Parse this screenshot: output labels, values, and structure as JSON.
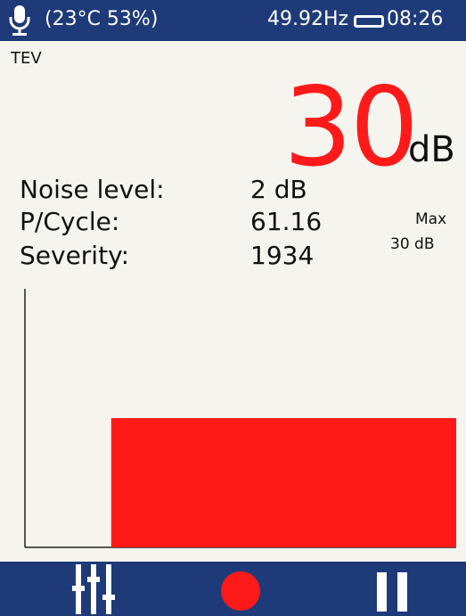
{
  "status": {
    "environment": "(23°C  53%)",
    "frequency": "49.92Hz",
    "time": "08:26"
  },
  "mode": "TEV",
  "reading": {
    "value": "30",
    "unit": "dB"
  },
  "stats": [
    {
      "label": "Noise level:",
      "value": "2 dB"
    },
    {
      "label": "P/Cycle:",
      "value": "61.16"
    },
    {
      "label": "Severity:",
      "value": "1934"
    }
  ],
  "max": {
    "label": "Max",
    "value": "30  dB"
  },
  "bar_level": {
    "start_fraction": 0.2,
    "level_fraction": 0.5
  },
  "colors": {
    "accent": "#ff1a1a",
    "bar": "#1e3a78",
    "background": "#f5f4ee"
  },
  "icons": [
    "microphone-icon",
    "battery-icon",
    "sliders-icon",
    "record-icon",
    "pause-icon"
  ]
}
